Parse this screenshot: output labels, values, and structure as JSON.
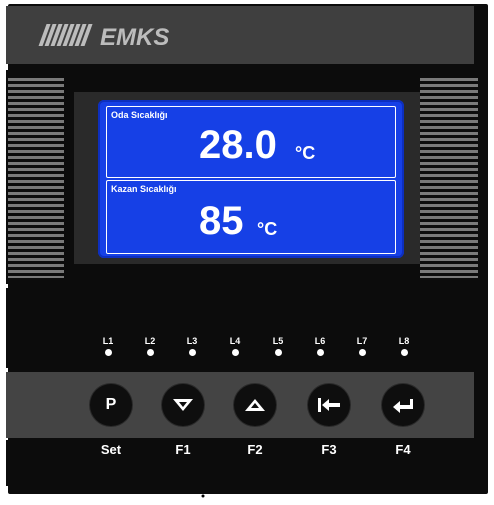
{
  "brand": {
    "logo_text": "EMKS",
    "logo_color": "#bcbcbc"
  },
  "display": {
    "background_color": "#1640e6",
    "rows": [
      {
        "label": "Oda Sıcaklığı",
        "value": "28.0",
        "unit": "°C"
      },
      {
        "label": "Kazan Sıcaklığı",
        "value": "85",
        "unit": "°C"
      }
    ]
  },
  "leds": [
    {
      "label": "L1",
      "icon": "led-dot"
    },
    {
      "label": "L2",
      "icon": "led-dot"
    },
    {
      "label": "L3",
      "icon": "led-dot"
    },
    {
      "label": "L4",
      "icon": "led-dot"
    },
    {
      "label": "L5",
      "icon": "led-dot"
    },
    {
      "label": "L6",
      "icon": "led-dot"
    },
    {
      "label": "L7",
      "icon": "led-dot"
    },
    {
      "label": "L8",
      "icon": "led-dot"
    }
  ],
  "buttons": [
    {
      "glyph": "P",
      "icon": "p-letter",
      "label": "Set"
    },
    {
      "glyph": "",
      "icon": "down-triangle-icon",
      "label": "F1"
    },
    {
      "glyph": "",
      "icon": "up-triangle-icon",
      "label": "F2"
    },
    {
      "glyph": "",
      "icon": "back-arrow-icon",
      "label": "F3"
    },
    {
      "glyph": "",
      "icon": "enter-arrow-icon",
      "label": "F4"
    }
  ]
}
